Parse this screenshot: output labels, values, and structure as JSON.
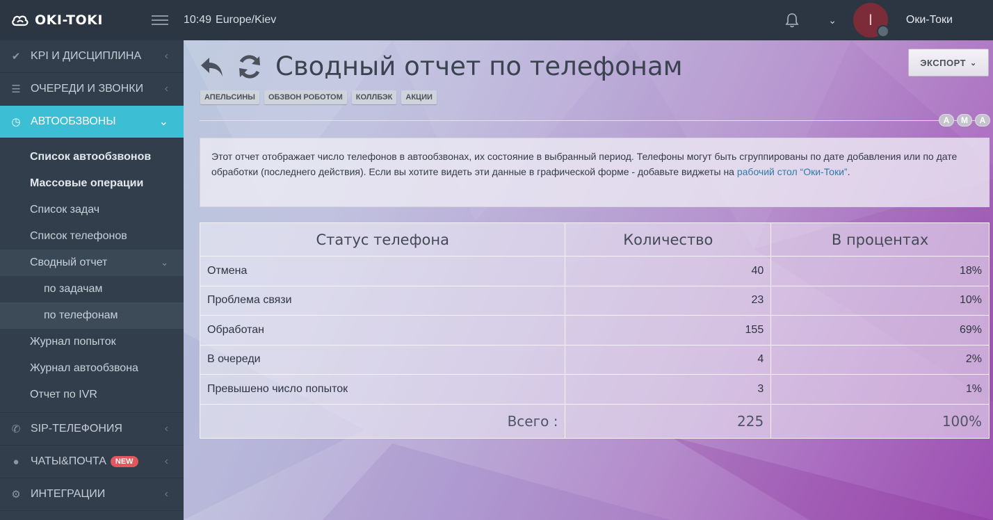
{
  "app": {
    "logo_text": "OKI-TOKI",
    "time": "10:49",
    "timezone": "Europe/Kiev",
    "username": "Оки-Токи",
    "avatar_initial": "I"
  },
  "sidebar": {
    "kpi": "KPI И ДИСЦИПЛИНА",
    "queues": "ОЧЕРЕДИ И ЗВОНКИ",
    "autocalls": "АВТООБЗВОНЫ",
    "sub": {
      "list": "Список автообзвонов",
      "bulk": "Массовые операции",
      "tasks": "Список задач",
      "phones": "Список телефонов",
      "summary": "Сводный отчет",
      "by_tasks": "по задачам",
      "by_phones": "по телефонам",
      "attempts_log": "Журнал попыток",
      "autocall_log": "Журнал автообзвона",
      "ivr_report": "Отчет по IVR"
    },
    "sip": "SIP-ТЕЛЕФОНИЯ",
    "chats": "ЧАТЫ&ПОЧТА",
    "chats_badge": "NEW",
    "integrations": "ИНТЕГРАЦИИ"
  },
  "main": {
    "title": "Сводный отчет по телефонам",
    "export": "ЭКСПОРТ",
    "tags": [
      "АПЕЛЬСИНЫ",
      "ОБЗВОН РОБОТОМ",
      "КОЛЛБЭК",
      "АКЦИИ"
    ],
    "ama": [
      "A",
      "M",
      "A"
    ],
    "info_text": "Этот отчет отображает число телефонов в автообзвонах, их состояние в выбранный период. Телефоны могут быть сгруппированы по дате добавления или по дате обработки (последнего действия). Если вы хотите видеть эти данные в графической форме - добавьте виджеты на ",
    "info_link": "рабочий стол “Оки-Токи”",
    "info_end": ".",
    "table": {
      "headers": [
        "Статус телефона",
        "Количество",
        "В процентах"
      ],
      "rows": [
        {
          "status": "Отмена",
          "count": "40",
          "percent": "18%"
        },
        {
          "status": "Проблема связи",
          "count": "23",
          "percent": "10%"
        },
        {
          "status": "Обработан",
          "count": "155",
          "percent": "69%"
        },
        {
          "status": "В очереди",
          "count": "4",
          "percent": "2%"
        },
        {
          "status": "Превышено число попыток",
          "count": "3",
          "percent": "1%"
        }
      ],
      "total_label": "Всего :",
      "total_count": "225",
      "total_percent": "100%"
    }
  },
  "colors": {
    "accent": "#3cbfd4",
    "sidebar": "#323e4b",
    "topbar": "#2b3642",
    "badge": "#e2575d"
  }
}
